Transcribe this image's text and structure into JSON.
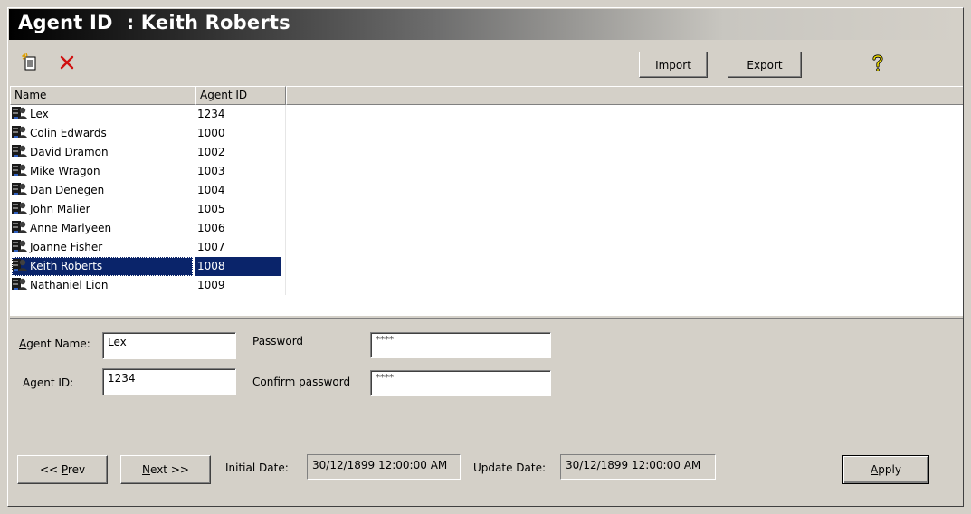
{
  "window": {
    "title": "Agent ID  : Keith Roberts"
  },
  "toolbar": {
    "new_icon": "new-document-icon",
    "delete_icon": "delete-x-icon",
    "import_label": "Import",
    "export_label": "Export",
    "help_icon": "help-question-icon"
  },
  "grid": {
    "columns": [
      "Name",
      "Agent ID"
    ],
    "rows": [
      {
        "name": "Lex",
        "agent_id": "1234"
      },
      {
        "name": "Colin Edwards",
        "agent_id": "1000"
      },
      {
        "name": "David Dramon",
        "agent_id": "1002"
      },
      {
        "name": "Mike Wragon",
        "agent_id": "1003"
      },
      {
        "name": "Dan Denegen",
        "agent_id": "1004"
      },
      {
        "name": "John Malier",
        "agent_id": "1005"
      },
      {
        "name": "Anne Marlyeen",
        "agent_id": "1006"
      },
      {
        "name": "Joanne Fisher",
        "agent_id": "1007"
      },
      {
        "name": "Keith Roberts",
        "agent_id": "1008",
        "selected": true
      },
      {
        "name": "Nathaniel Lion",
        "agent_id": "1009"
      }
    ]
  },
  "form": {
    "agent_name_label_u": "A",
    "agent_name_label_rest": "gent Name:",
    "agent_name_value": "Lex",
    "agent_id_label": "Agent ID:",
    "agent_id_value": "1234",
    "password_label": "Password",
    "password_value": "****",
    "confirm_password_label": "Confirm password",
    "confirm_password_value": "****"
  },
  "footer": {
    "prev_prefix": "<< ",
    "prev_u": "P",
    "prev_rest": "rev",
    "next_u": "N",
    "next_rest": "ext >>",
    "initial_date_label": "Initial Date:",
    "initial_date_value": "30/12/1899 12:00:00 AM",
    "update_date_label": "Update Date:",
    "update_date_value": "30/12/1899 12:00:00 AM",
    "apply_u": "A",
    "apply_rest": "pply"
  },
  "colors": {
    "selection": "#0a246a",
    "face": "#d4d0c8"
  }
}
